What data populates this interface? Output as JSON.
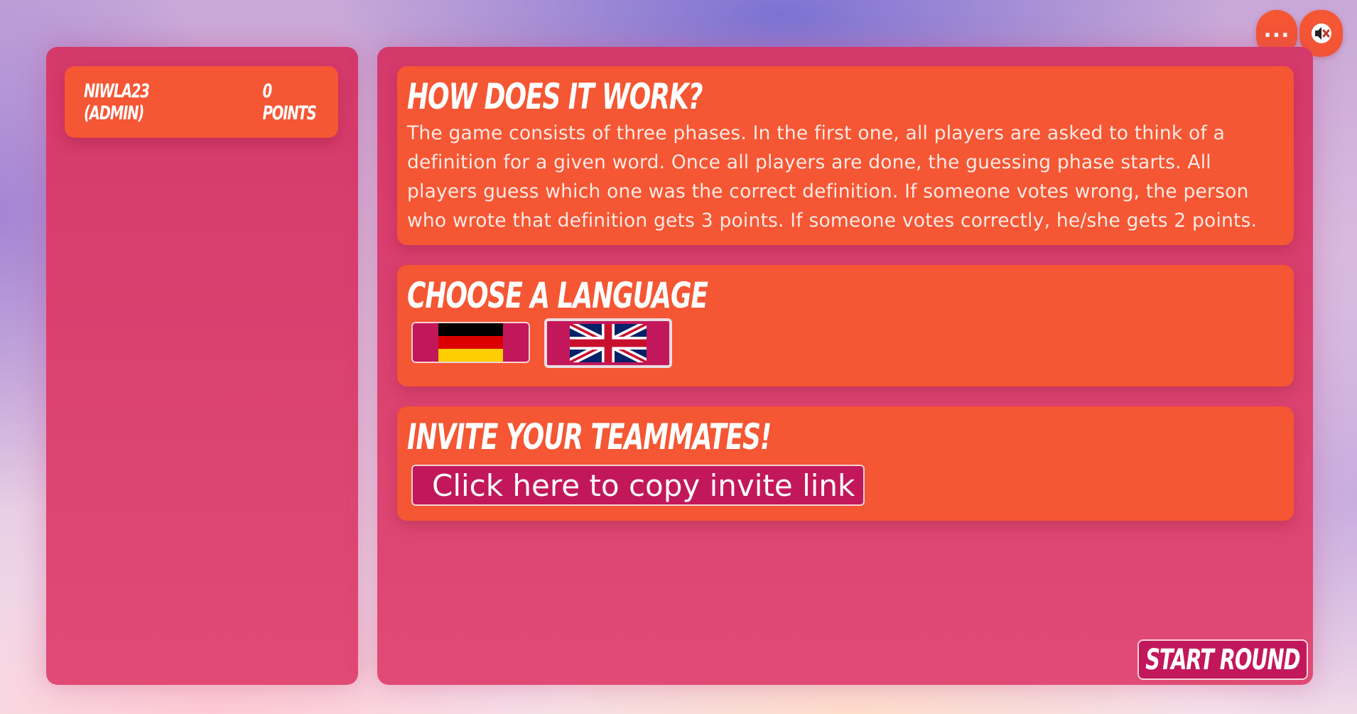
{
  "top_controls": {
    "more_label": "...",
    "more_icon": "more-dots-icon",
    "mute_icon": "speaker-muted-icon"
  },
  "players": [
    {
      "name": "NIWLA23 (ADMIN)",
      "points": "0 POINTS"
    }
  ],
  "how_it_works": {
    "title": "HOW DOES IT WORK?",
    "description": "The game consists of three phases. In the first one, all players are asked to think of a definition for a given word. Once all players are done, the guessing phase starts. All players guess which one was the correct definition. If someone votes wrong, the person who wrote that definition gets 3 points. If someone votes correctly, he/she gets 2 points."
  },
  "language": {
    "title": "CHOOSE A LANGUAGE",
    "options": [
      {
        "code": "de",
        "icon": "german-flag-icon",
        "selected": false
      },
      {
        "code": "en",
        "icon": "uk-flag-icon",
        "selected": true
      }
    ]
  },
  "invite": {
    "title": "INVITE YOUR TEAMMATES!",
    "button_label": "Click here to copy invite link"
  },
  "start_button_label": "START ROUND",
  "colors": {
    "panel": "#d63b6d",
    "card": "#f55633",
    "button": "#c2185b",
    "text": "#ffffff"
  }
}
